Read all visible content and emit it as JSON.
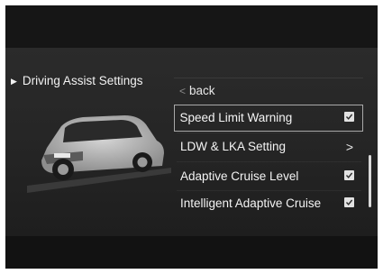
{
  "header": {
    "title": "Driving Assist Settings"
  },
  "menu": {
    "back_label": "back",
    "items": [
      {
        "label": "Speed Limit Warning",
        "control": "checkbox",
        "checked": true,
        "selected": true
      },
      {
        "label": "LDW & LKA Setting",
        "control": "arrow",
        "arrow_glyph": ">"
      },
      {
        "label": "Adaptive Cruise Level",
        "control": "checkbox",
        "checked": true
      },
      {
        "label": "Intelligent Adaptive Cruise",
        "control": "checkbox",
        "checked": true
      }
    ]
  },
  "icons": {
    "header": "triangle-right-icon",
    "back": "chevron-left-icon",
    "arrow": "chevron-right-icon",
    "check": "checkbox-checked-icon",
    "car": "suv-car-image"
  },
  "colors": {
    "background": "#262626",
    "text": "#f4f4f4",
    "selection_border": "#a9a9a9",
    "checkbox": "#e2e2e2"
  }
}
